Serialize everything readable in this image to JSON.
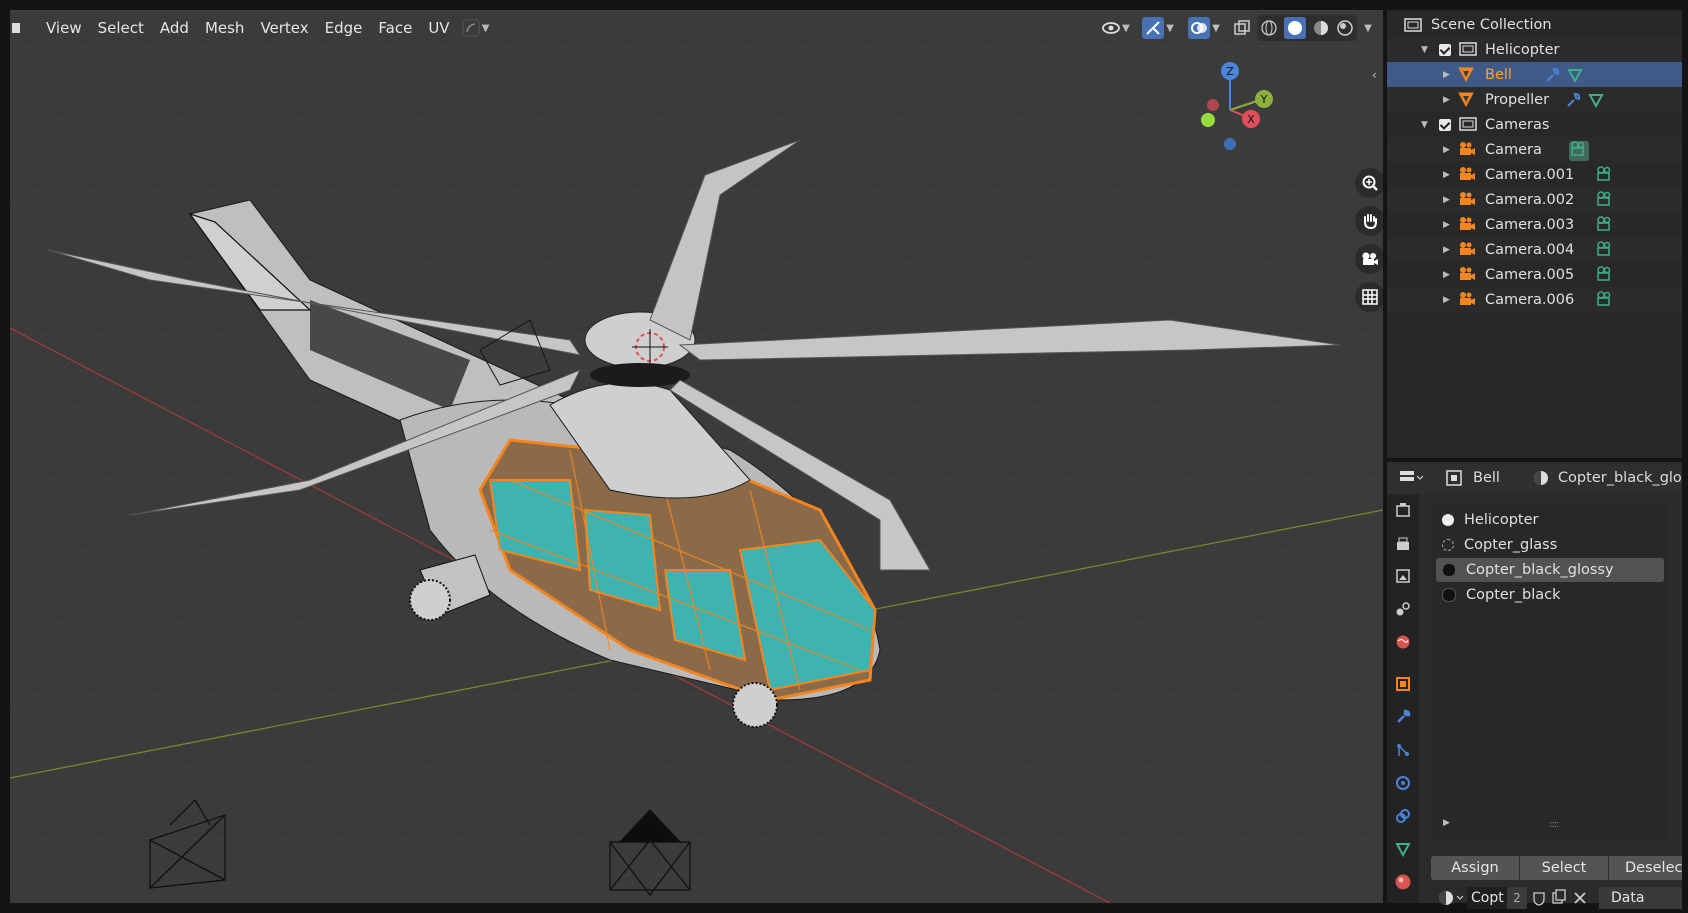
{
  "viewport": {
    "menu": [
      "View",
      "Select",
      "Add",
      "Mesh",
      "Vertex",
      "Edge",
      "Face",
      "UV"
    ],
    "gizmo_axes": {
      "z": "Z",
      "y": "Y",
      "x": "X"
    }
  },
  "outliner": {
    "root": "Scene Collection",
    "rows": [
      {
        "label": "Helicopter",
        "type": "collection",
        "expanded": true,
        "indent": 1
      },
      {
        "label": "Bell",
        "type": "mesh",
        "indent": 2,
        "selected": true
      },
      {
        "label": "Propeller",
        "type": "mesh",
        "indent": 2
      },
      {
        "label": "Cameras",
        "type": "collection",
        "expanded": true,
        "indent": 1
      },
      {
        "label": "Camera",
        "type": "camera",
        "indent": 2
      },
      {
        "label": "Camera.001",
        "type": "camera",
        "indent": 2
      },
      {
        "label": "Camera.002",
        "type": "camera",
        "indent": 2
      },
      {
        "label": "Camera.003",
        "type": "camera",
        "indent": 2
      },
      {
        "label": "Camera.004",
        "type": "camera",
        "indent": 2
      },
      {
        "label": "Camera.005",
        "type": "camera",
        "indent": 2
      },
      {
        "label": "Camera.006",
        "type": "camera",
        "indent": 2
      }
    ]
  },
  "properties": {
    "object_name": "Bell",
    "material_name": "Copter_black_glo",
    "materials": [
      {
        "label": "Helicopter",
        "color": "#f2f2f2"
      },
      {
        "label": "Copter_glass",
        "color": "#2b2b2b"
      },
      {
        "label": "Copter_black_glossy",
        "color": "#111111",
        "selected": true
      },
      {
        "label": "Copter_black",
        "color": "#111111"
      }
    ],
    "buttons": {
      "assign": "Assign",
      "select": "Select",
      "deselect": "Deselec"
    },
    "slot_name": "Copt",
    "user_count": "2",
    "link_mode": "Data"
  },
  "colors": {
    "viewport_bg": "#3b3b3b",
    "selection_highlight": "#3f5a87",
    "active_orange": "#f5851f",
    "glass_teal": "#3fb3b0",
    "camera_green": "#3fae8a"
  }
}
